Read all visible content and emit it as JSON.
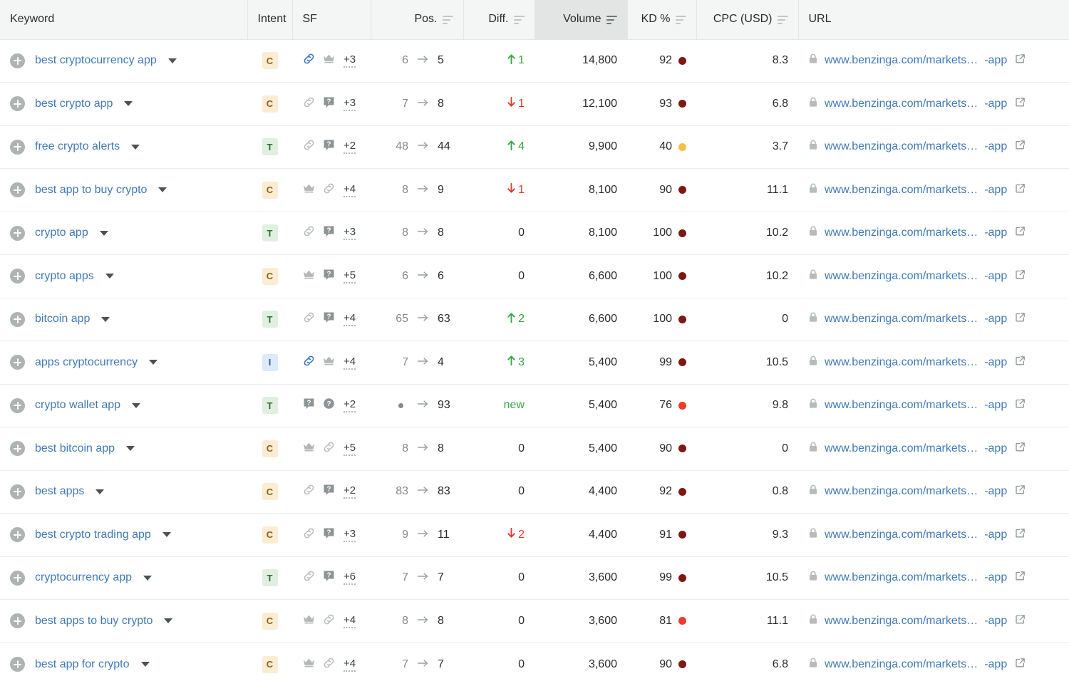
{
  "table": {
    "columns": [
      {
        "key": "keyword",
        "label": "Keyword",
        "align": "left",
        "sortable": false,
        "active_sort": false
      },
      {
        "key": "intent",
        "label": "Intent",
        "align": "left",
        "sortable": false,
        "active_sort": false
      },
      {
        "key": "sf",
        "label": "SF",
        "align": "left",
        "sortable": false,
        "active_sort": false
      },
      {
        "key": "pos",
        "label": "Pos.",
        "align": "right",
        "sortable": true,
        "active_sort": false
      },
      {
        "key": "diff",
        "label": "Diff.",
        "align": "right",
        "sortable": true,
        "active_sort": false
      },
      {
        "key": "volume",
        "label": "Volume",
        "align": "right",
        "sortable": true,
        "active_sort": true
      },
      {
        "key": "kd",
        "label": "KD %",
        "align": "right",
        "sortable": true,
        "active_sort": false
      },
      {
        "key": "cpc",
        "label": "CPC (USD)",
        "align": "right",
        "sortable": true,
        "active_sort": false
      },
      {
        "key": "url",
        "label": "URL",
        "align": "left",
        "sortable": false,
        "active_sort": false
      }
    ],
    "colors": {
      "link": "#417ab6",
      "intent_commercial_bg": "#fbecd3",
      "intent_commercial_fg": "#8a6516",
      "intent_transactional_bg": "#dff0e0",
      "intent_transactional_fg": "#356b37",
      "intent_informational_bg": "#dceafa",
      "intent_informational_fg": "#2a62ac",
      "kd_very_high": "#7d1812",
      "kd_high": "#ef3b2a",
      "kd_medium": "#f9bf45",
      "diff_up": "#37a745",
      "diff_down": "#e2382b",
      "header_bg": "#f4f5f5",
      "header_active_bg": "#e3e5e5"
    },
    "rows": [
      {
        "keyword": "best cryptocurrency app",
        "intent": "C",
        "sf_icons": [
          {
            "name": "link-icon",
            "active": true
          },
          {
            "name": "crown-icon",
            "active": false
          }
        ],
        "sf_more": "+3",
        "pos_from": "6",
        "pos_to": "5",
        "diff": "1",
        "diff_dir": "up",
        "volume": "14,800",
        "kd": "92",
        "kd_level": "very_high",
        "cpc": "8.3",
        "url": "www.benzinga.com/markets…",
        "url_suffix": "-app"
      },
      {
        "keyword": "best crypto app",
        "intent": "C",
        "sf_icons": [
          {
            "name": "link-icon",
            "active": false
          },
          {
            "name": "question-box-icon",
            "active": false
          }
        ],
        "sf_more": "+3",
        "pos_from": "7",
        "pos_to": "8",
        "diff": "1",
        "diff_dir": "down",
        "volume": "12,100",
        "kd": "93",
        "kd_level": "very_high",
        "cpc": "6.8",
        "url": "www.benzinga.com/markets…",
        "url_suffix": "-app"
      },
      {
        "keyword": "free crypto alerts",
        "intent": "T",
        "sf_icons": [
          {
            "name": "link-icon",
            "active": false
          },
          {
            "name": "question-box-icon",
            "active": false
          }
        ],
        "sf_more": "+2",
        "pos_from": "48",
        "pos_to": "44",
        "diff": "4",
        "diff_dir": "up",
        "volume": "9,900",
        "kd": "40",
        "kd_level": "medium",
        "cpc": "3.7",
        "url": "www.benzinga.com/markets…",
        "url_suffix": "-app"
      },
      {
        "keyword": "best app to buy crypto",
        "intent": "C",
        "sf_icons": [
          {
            "name": "crown-icon",
            "active": false
          },
          {
            "name": "link-icon",
            "active": false
          }
        ],
        "sf_more": "+4",
        "pos_from": "8",
        "pos_to": "9",
        "diff": "1",
        "diff_dir": "down",
        "volume": "8,100",
        "kd": "90",
        "kd_level": "very_high",
        "cpc": "11.1",
        "url": "www.benzinga.com/markets…",
        "url_suffix": "-app"
      },
      {
        "keyword": "crypto app",
        "intent": "T",
        "sf_icons": [
          {
            "name": "link-icon",
            "active": false
          },
          {
            "name": "question-box-icon",
            "active": false
          }
        ],
        "sf_more": "+3",
        "pos_from": "8",
        "pos_to": "8",
        "diff": "0",
        "diff_dir": "none",
        "volume": "8,100",
        "kd": "100",
        "kd_level": "very_high",
        "cpc": "10.2",
        "url": "www.benzinga.com/markets…",
        "url_suffix": "-app"
      },
      {
        "keyword": "crypto apps",
        "intent": "C",
        "sf_icons": [
          {
            "name": "crown-icon",
            "active": false
          },
          {
            "name": "question-box-icon",
            "active": false
          }
        ],
        "sf_more": "+5",
        "pos_from": "6",
        "pos_to": "6",
        "diff": "0",
        "diff_dir": "none",
        "volume": "6,600",
        "kd": "100",
        "kd_level": "very_high",
        "cpc": "10.2",
        "url": "www.benzinga.com/markets…",
        "url_suffix": "-app"
      },
      {
        "keyword": "bitcoin app",
        "intent": "T",
        "sf_icons": [
          {
            "name": "link-icon",
            "active": false
          },
          {
            "name": "question-box-icon",
            "active": false
          }
        ],
        "sf_more": "+4",
        "pos_from": "65",
        "pos_to": "63",
        "diff": "2",
        "diff_dir": "up",
        "volume": "6,600",
        "kd": "100",
        "kd_level": "very_high",
        "cpc": "0",
        "url": "www.benzinga.com/markets…",
        "url_suffix": "-app"
      },
      {
        "keyword": "apps cryptocurrency",
        "intent": "I",
        "sf_icons": [
          {
            "name": "link-icon",
            "active": true
          },
          {
            "name": "crown-icon",
            "active": false
          }
        ],
        "sf_more": "+4",
        "pos_from": "7",
        "pos_to": "4",
        "diff": "3",
        "diff_dir": "up",
        "volume": "5,400",
        "kd": "99",
        "kd_level": "very_high",
        "cpc": "10.5",
        "url": "www.benzinga.com/markets…",
        "url_suffix": "-app"
      },
      {
        "keyword": "crypto wallet app",
        "intent": "T",
        "sf_icons": [
          {
            "name": "question-box-icon",
            "active": false
          },
          {
            "name": "question-circle-icon",
            "active": false
          }
        ],
        "sf_more": "+2",
        "pos_from": "",
        "pos_to": "93",
        "diff": "new",
        "diff_dir": "new",
        "volume": "5,400",
        "kd": "76",
        "kd_level": "high",
        "cpc": "9.8",
        "url": "www.benzinga.com/markets…",
        "url_suffix": "-app"
      },
      {
        "keyword": "best bitcoin app",
        "intent": "C",
        "sf_icons": [
          {
            "name": "crown-icon",
            "active": false
          },
          {
            "name": "link-icon",
            "active": false
          }
        ],
        "sf_more": "+5",
        "pos_from": "8",
        "pos_to": "8",
        "diff": "0",
        "diff_dir": "none",
        "volume": "5,400",
        "kd": "90",
        "kd_level": "very_high",
        "cpc": "0",
        "url": "www.benzinga.com/markets…",
        "url_suffix": "-app"
      },
      {
        "keyword": "best apps",
        "intent": "C",
        "sf_icons": [
          {
            "name": "link-icon",
            "active": false
          },
          {
            "name": "question-box-icon",
            "active": false
          }
        ],
        "sf_more": "+2",
        "pos_from": "83",
        "pos_to": "83",
        "diff": "0",
        "diff_dir": "none",
        "volume": "4,400",
        "kd": "92",
        "kd_level": "very_high",
        "cpc": "0.8",
        "url": "www.benzinga.com/markets…",
        "url_suffix": "-app"
      },
      {
        "keyword": "best crypto trading app",
        "intent": "C",
        "sf_icons": [
          {
            "name": "link-icon",
            "active": false
          },
          {
            "name": "question-box-icon",
            "active": false
          }
        ],
        "sf_more": "+3",
        "pos_from": "9",
        "pos_to": "11",
        "diff": "2",
        "diff_dir": "down",
        "volume": "4,400",
        "kd": "91",
        "kd_level": "very_high",
        "cpc": "9.3",
        "url": "www.benzinga.com/markets…",
        "url_suffix": "-app"
      },
      {
        "keyword": "cryptocurrency app",
        "intent": "T",
        "sf_icons": [
          {
            "name": "link-icon",
            "active": false
          },
          {
            "name": "question-box-icon",
            "active": false
          }
        ],
        "sf_more": "+6",
        "pos_from": "7",
        "pos_to": "7",
        "diff": "0",
        "diff_dir": "none",
        "volume": "3,600",
        "kd": "99",
        "kd_level": "very_high",
        "cpc": "10.5",
        "url": "www.benzinga.com/markets…",
        "url_suffix": "-app"
      },
      {
        "keyword": "best apps to buy crypto",
        "intent": "C",
        "sf_icons": [
          {
            "name": "crown-icon",
            "active": false
          },
          {
            "name": "link-icon",
            "active": false
          }
        ],
        "sf_more": "+4",
        "pos_from": "8",
        "pos_to": "8",
        "diff": "0",
        "diff_dir": "none",
        "volume": "3,600",
        "kd": "81",
        "kd_level": "high",
        "cpc": "11.1",
        "url": "www.benzinga.com/markets…",
        "url_suffix": "-app"
      },
      {
        "keyword": "best app for crypto",
        "intent": "C",
        "sf_icons": [
          {
            "name": "crown-icon",
            "active": false
          },
          {
            "name": "link-icon",
            "active": false
          }
        ],
        "sf_more": "+4",
        "pos_from": "7",
        "pos_to": "7",
        "diff": "0",
        "diff_dir": "none",
        "volume": "3,600",
        "kd": "90",
        "kd_level": "very_high",
        "cpc": "6.8",
        "url": "www.benzinga.com/markets…",
        "url_suffix": "-app"
      }
    ]
  }
}
